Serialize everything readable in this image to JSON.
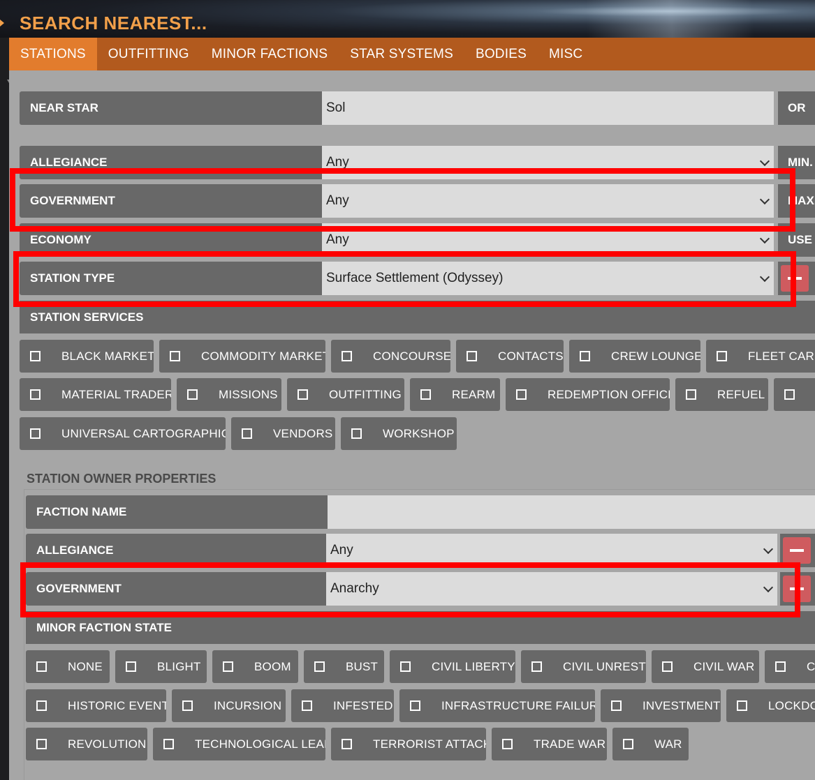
{
  "header": {
    "title": "SEARCH NEAREST..."
  },
  "tabs": [
    {
      "label": "STATIONS",
      "active": true
    },
    {
      "label": "OUTFITTING",
      "active": false
    },
    {
      "label": "MINOR FACTIONS",
      "active": false
    },
    {
      "label": "STAR SYSTEMS",
      "active": false
    },
    {
      "label": "BODIES",
      "active": false
    },
    {
      "label": "MISC",
      "active": false
    }
  ],
  "form": {
    "near_star": {
      "label": "NEAR STAR",
      "value": "Sol",
      "side": "OR"
    },
    "allegiance": {
      "label": "ALLEGIANCE",
      "value": "Any",
      "side": "MIN."
    },
    "government": {
      "label": "GOVERNMENT",
      "value": "Any",
      "side": "MAX."
    },
    "economy": {
      "label": "ECONOMY",
      "value": "Any",
      "side": "USE S"
    },
    "station_type": {
      "label": "STATION TYPE",
      "value": "Surface Settlement (Odyssey)"
    }
  },
  "station_services": {
    "label": "STATION SERVICES",
    "items": [
      "BLACK MARKET",
      "COMMODITY MARKET",
      "CONCOURSE",
      "CONTACTS",
      "CREW LOUNGE",
      "FLEET CARRI",
      "MATERIAL TRADER",
      "MISSIONS",
      "OUTFITTING",
      "REARM",
      "REDEMPTION OFFICE",
      "REFUEL",
      "",
      "UNIVERSAL CARTOGRAPHICS",
      "VENDORS",
      "WORKSHOP"
    ]
  },
  "owner": {
    "title": "STATION OWNER PROPERTIES",
    "faction_name": {
      "label": "FACTION NAME",
      "value": ""
    },
    "allegiance": {
      "label": "ALLEGIANCE",
      "value": "Any"
    },
    "government": {
      "label": "GOVERNMENT",
      "value": "Anarchy"
    },
    "state_label": "MINOR FACTION STATE",
    "states": [
      "NONE",
      "BLIGHT",
      "BOOM",
      "BUST",
      "CIVIL LIBERTY",
      "CIVIL UNREST",
      "CIVIL WAR",
      "C",
      "HISTORIC EVENT",
      "INCURSION",
      "INFESTED",
      "INFRASTRUCTURE FAILURE",
      "INVESTMENT",
      "LOCKDOW",
      "REVOLUTION",
      "TECHNOLOGICAL LEAP",
      "TERRORIST ATTACK",
      "TRADE WAR",
      "WAR"
    ]
  },
  "colors": {
    "accent": "#e27c2d",
    "tab_bar": "#b25a1e",
    "title": "#f2a04a",
    "label_bg": "#686868",
    "highlight": "#ff0000"
  }
}
